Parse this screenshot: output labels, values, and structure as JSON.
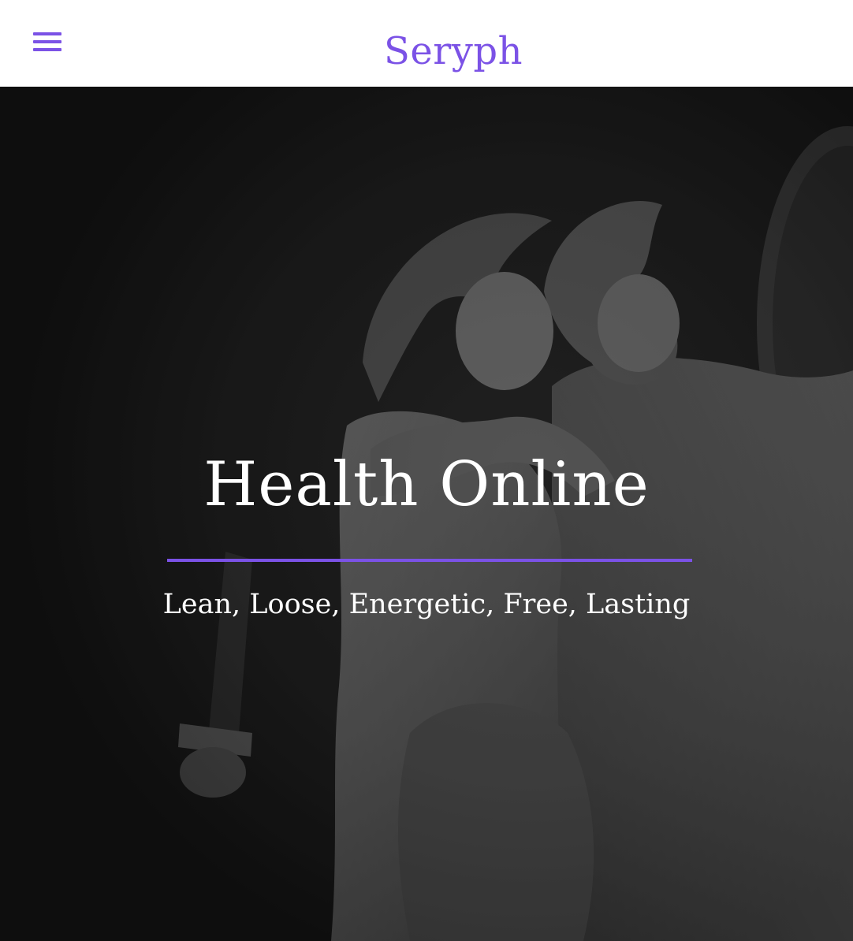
{
  "colors": {
    "accent": "#7b52e6",
    "hero_overlay": "#121212",
    "header_background": "#ffffff"
  },
  "header": {
    "menu_icon": "hamburger-menu-icon",
    "brand": "Seryph"
  },
  "hero": {
    "title": "Health Online",
    "tagline": "Lean, Loose, Energetic, Free, Lasting",
    "background_image": "statue-photo"
  }
}
